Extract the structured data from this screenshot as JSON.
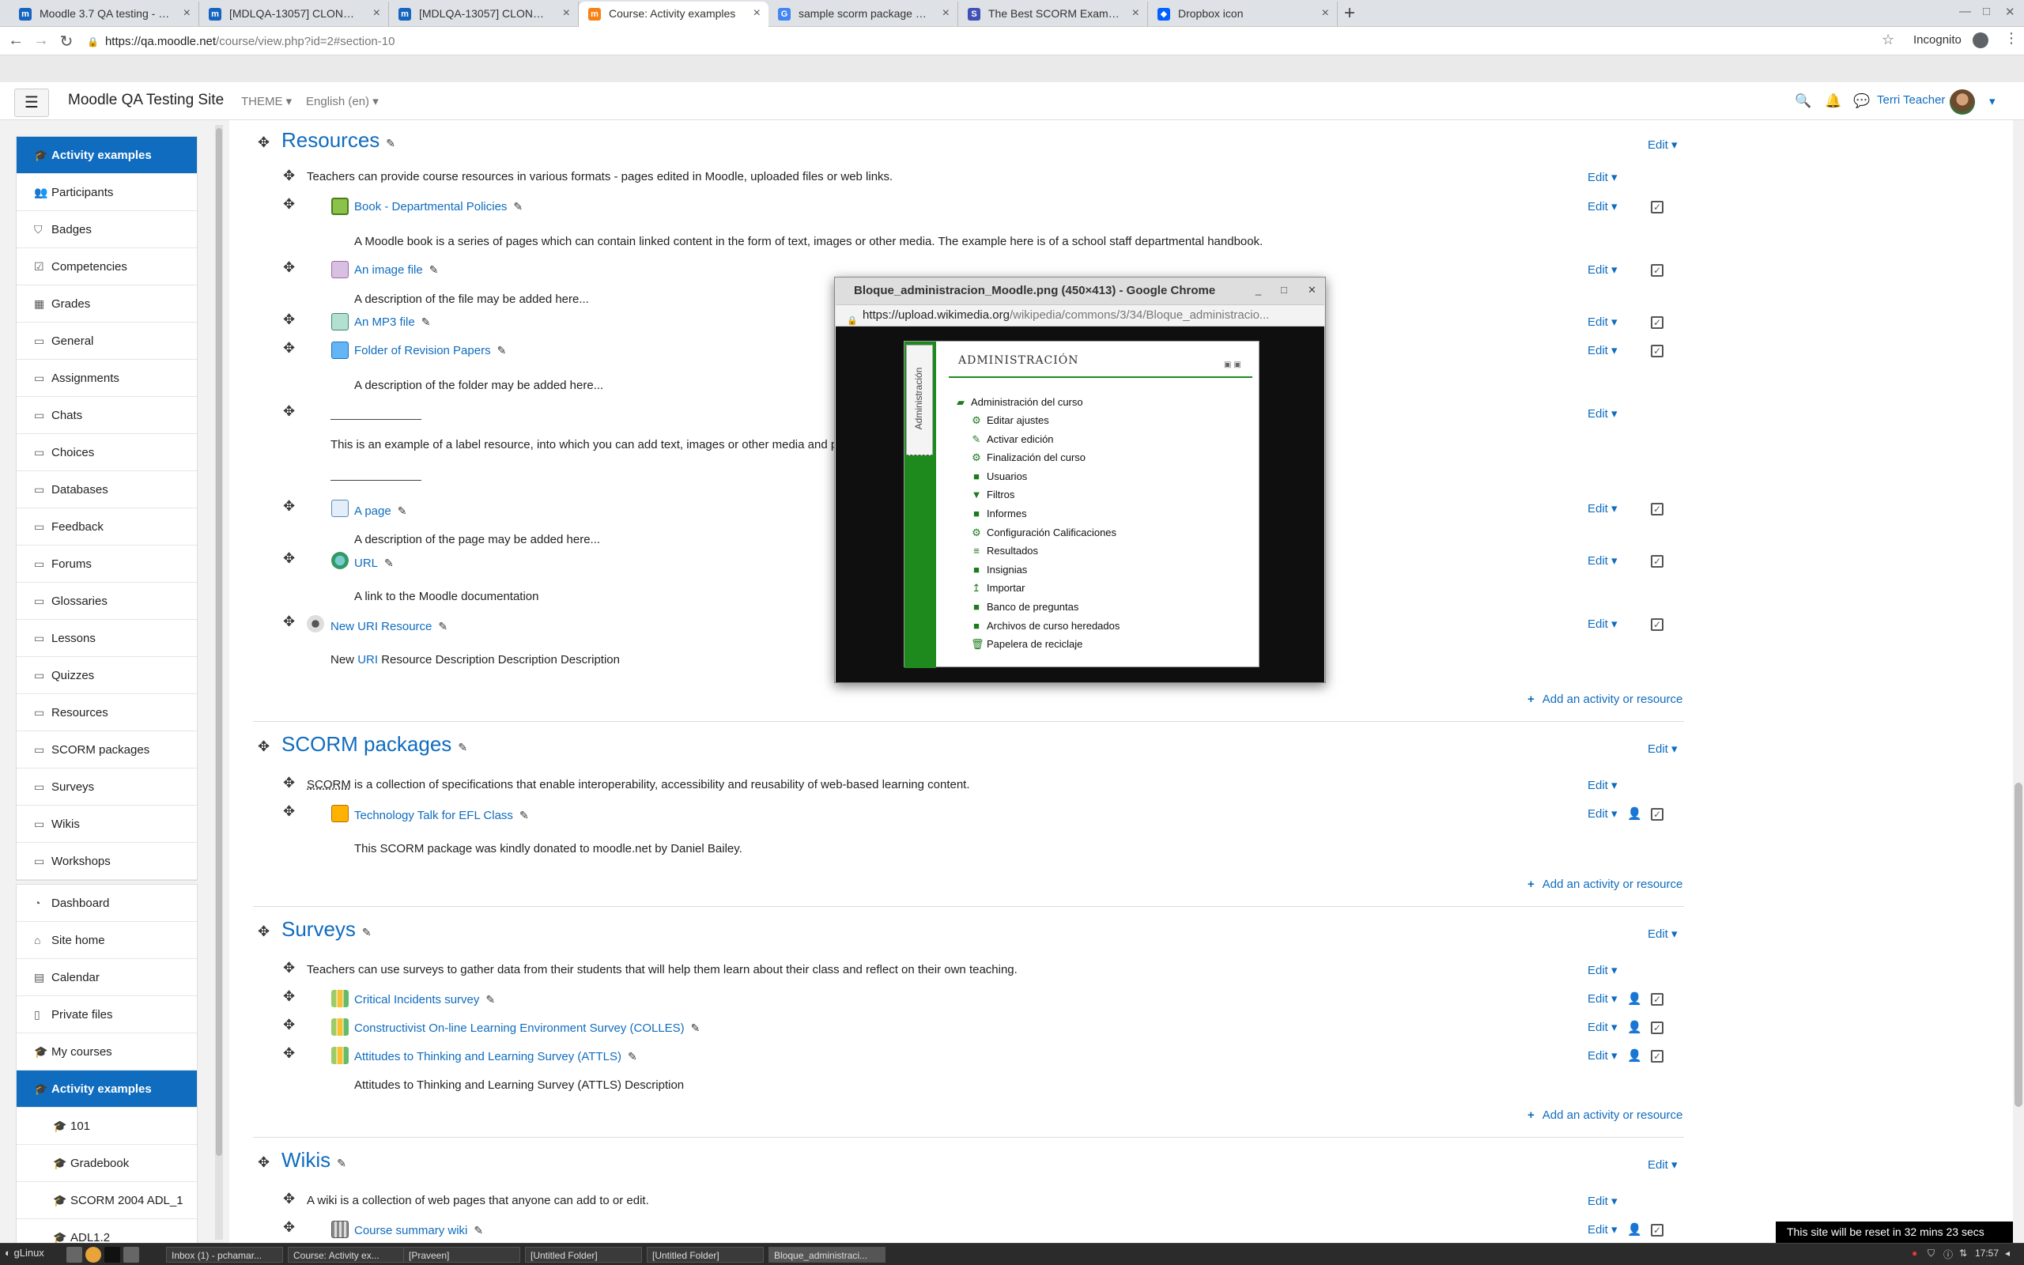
{
  "browser": {
    "tabs": [
      {
        "title": "Moodle 3.7 QA testing - Mood",
        "fav": "m",
        "color": "#1565c0"
      },
      {
        "title": "[MDLQA-13057] CLONE - A tr",
        "fav": "m",
        "color": "#1565c0"
      },
      {
        "title": "[MDLQA-13057] CLONE - A t",
        "fav": "m",
        "color": "#1565c0"
      },
      {
        "title": "Course: Activity examples",
        "fav": "m",
        "color": "#f98012"
      },
      {
        "title": "sample scorm package dow",
        "fav": "G",
        "color": "#4285f4"
      },
      {
        "title": "The Best SCORM Examples: S",
        "fav": "S",
        "color": "#3f51b5"
      },
      {
        "title": "Dropbox icon",
        "fav": "◆",
        "color": "#0061ff"
      }
    ],
    "url_host": "https://qa.moodle.net",
    "url_path": "/course/view.php?id=2#section-10",
    "incognito_label": "Incognito"
  },
  "navbar": {
    "site_name": "Moodle QA Testing Site",
    "theme_label": "THEME",
    "language_label": "English (en)",
    "user_name": "Terri Teacher"
  },
  "drawer": {
    "course_items": [
      {
        "label": "Activity examples",
        "icon": "cap-icon",
        "glyph": "🎓",
        "active": true
      },
      {
        "label": "Participants",
        "icon": "users-icon",
        "glyph": "👥"
      },
      {
        "label": "Badges",
        "icon": "shield-icon",
        "glyph": "⛉"
      },
      {
        "label": "Competencies",
        "icon": "check-square-icon",
        "glyph": "☑"
      },
      {
        "label": "Grades",
        "icon": "table-icon",
        "glyph": "▦"
      },
      {
        "label": "General",
        "icon": "folder-icon",
        "glyph": "▭"
      },
      {
        "label": "Assignments",
        "icon": "folder-icon",
        "glyph": "▭"
      },
      {
        "label": "Chats",
        "icon": "folder-icon",
        "glyph": "▭"
      },
      {
        "label": "Choices",
        "icon": "folder-icon",
        "glyph": "▭"
      },
      {
        "label": "Databases",
        "icon": "folder-icon",
        "glyph": "▭"
      },
      {
        "label": "Feedback",
        "icon": "folder-icon",
        "glyph": "▭"
      },
      {
        "label": "Forums",
        "icon": "folder-icon",
        "glyph": "▭"
      },
      {
        "label": "Glossaries",
        "icon": "folder-icon",
        "glyph": "▭"
      },
      {
        "label": "Lessons",
        "icon": "folder-icon",
        "glyph": "▭"
      },
      {
        "label": "Quizzes",
        "icon": "folder-icon",
        "glyph": "▭"
      },
      {
        "label": "Resources",
        "icon": "folder-icon",
        "glyph": "▭"
      },
      {
        "label": "SCORM packages",
        "icon": "folder-icon",
        "glyph": "▭"
      },
      {
        "label": "Surveys",
        "icon": "folder-icon",
        "glyph": "▭"
      },
      {
        "label": "Wikis",
        "icon": "folder-icon",
        "glyph": "▭"
      },
      {
        "label": "Workshops",
        "icon": "folder-icon",
        "glyph": "▭"
      }
    ],
    "site_items": [
      {
        "label": "Dashboard",
        "icon": "dashboard-icon",
        "glyph": "◔"
      },
      {
        "label": "Site home",
        "icon": "home-icon",
        "glyph": "⌂"
      },
      {
        "label": "Calendar",
        "icon": "calendar-icon",
        "glyph": "▤"
      },
      {
        "label": "Private files",
        "icon": "file-icon",
        "glyph": "▯"
      },
      {
        "label": "My courses",
        "icon": "cap-icon",
        "glyph": "🎓"
      },
      {
        "label": "Activity examples",
        "icon": "cap-icon",
        "glyph": "🎓",
        "active": true
      },
      {
        "label": "101",
        "icon": "cap-icon",
        "glyph": "🎓",
        "sub": true
      },
      {
        "label": "Gradebook",
        "icon": "cap-icon",
        "glyph": "🎓",
        "sub": true
      },
      {
        "label": "SCORM 2004 ADL_1",
        "icon": "cap-icon",
        "glyph": "🎓",
        "sub": true
      },
      {
        "label": "ADL1.2",
        "icon": "cap-icon",
        "glyph": "🎓",
        "sub": true
      }
    ]
  },
  "sections": {
    "resources": {
      "title": "Resources",
      "summary": "Teachers can provide course resources in various formats - pages edited in Moodle, uploaded files or web links.",
      "book": "Book - Departmental Policies",
      "book_desc": "A  Moodle book is a series of pages which can contain linked content  in the form of text, images or other media. The example here is of a school staff departmental handbook.",
      "image": "An image file",
      "image_desc": "A description of the file may be added here...",
      "mp3": "An MP3 file",
      "folder": "Folder of Revision Papers",
      "folder_desc": "A description of the folder may be added here...",
      "label_text": "This is an example of a label resource, into which you can add text, images or other media and p",
      "page": "A page",
      "page_desc": "A description of the page may be added here...",
      "url": "URL",
      "url_desc": "A link to the Moodle documentation",
      "uri": "New URI Resource",
      "uri_desc_1": "New ",
      "uri_desc_link": "URI",
      "uri_desc_2": " Resource Description  Description Description"
    },
    "scorm": {
      "title": "SCORM packages",
      "summary_abbr": "SCORM",
      "summary": " is a collection of specifications that enable interoperability, accessibility and reusability of web-based learning content.",
      "item": "Technology Talk for EFL Class",
      "item_desc": "This SCORM package was kindly donated to moodle.net by Daniel Bailey."
    },
    "surveys": {
      "title": "Surveys",
      "summary": "Teachers can use surveys to gather data from their students that will help them learn about their class and reflect on their own teaching.",
      "item1": "Critical Incidents survey",
      "item2": "Constructivist On-line Learning Environment Survey (COLLES)",
      "item3": "Attitudes to Thinking and Learning Survey (ATTLS)",
      "item3_desc": "Attitudes to Thinking and Learning Survey (ATTLS) Description"
    },
    "wikis": {
      "title": "Wikis",
      "summary": "A wiki is a collection of web pages that anyone can add to or edit.",
      "item": "Course summary wiki"
    },
    "edit_label": "Edit",
    "add_label": "Add an activity or resource"
  },
  "popup": {
    "title": "Bloque_administracion_Moodle.png (450×413) - Google Chrome",
    "url_host": "https://upload.wikimedia.org",
    "url_path": "/wikipedia/commons/3/34/Bloque_administracio...",
    "image": {
      "tab_label": "Administración",
      "title": "ADMINISTRACIÓN",
      "root": "Administración del curso",
      "items": [
        {
          "label": "Editar ajustes",
          "glyph": "⚙"
        },
        {
          "label": "Activar edición",
          "glyph": "✎"
        },
        {
          "label": "Finalización del curso",
          "glyph": "⚙"
        },
        {
          "label": "Usuarios",
          "glyph": "■"
        },
        {
          "label": "Filtros",
          "glyph": "▼"
        },
        {
          "label": "Informes",
          "glyph": "■"
        },
        {
          "label": "Configuración Calificaciones",
          "glyph": "⚙"
        },
        {
          "label": "Resultados",
          "glyph": "≡"
        },
        {
          "label": "Insignias",
          "glyph": "■"
        },
        {
          "label": "Importar",
          "glyph": "↥"
        },
        {
          "label": "Banco de preguntas",
          "glyph": "■"
        },
        {
          "label": "Archivos de curso heredados",
          "glyph": "■"
        },
        {
          "label": "Papelera de reciclaje",
          "glyph": "🗑"
        }
      ]
    }
  },
  "taskbar": {
    "start_label": "gLinux",
    "windows": [
      "Inbox (1) - pchamar...",
      "Course: Activity ex...",
      "[Praveen]",
      "[Untitled Folder]",
      "[Untitled Folder]",
      "Bloque_administraci..."
    ],
    "clock": "17:57"
  },
  "reset_notice": "This site will be reset in 32 mins 23 secs"
}
